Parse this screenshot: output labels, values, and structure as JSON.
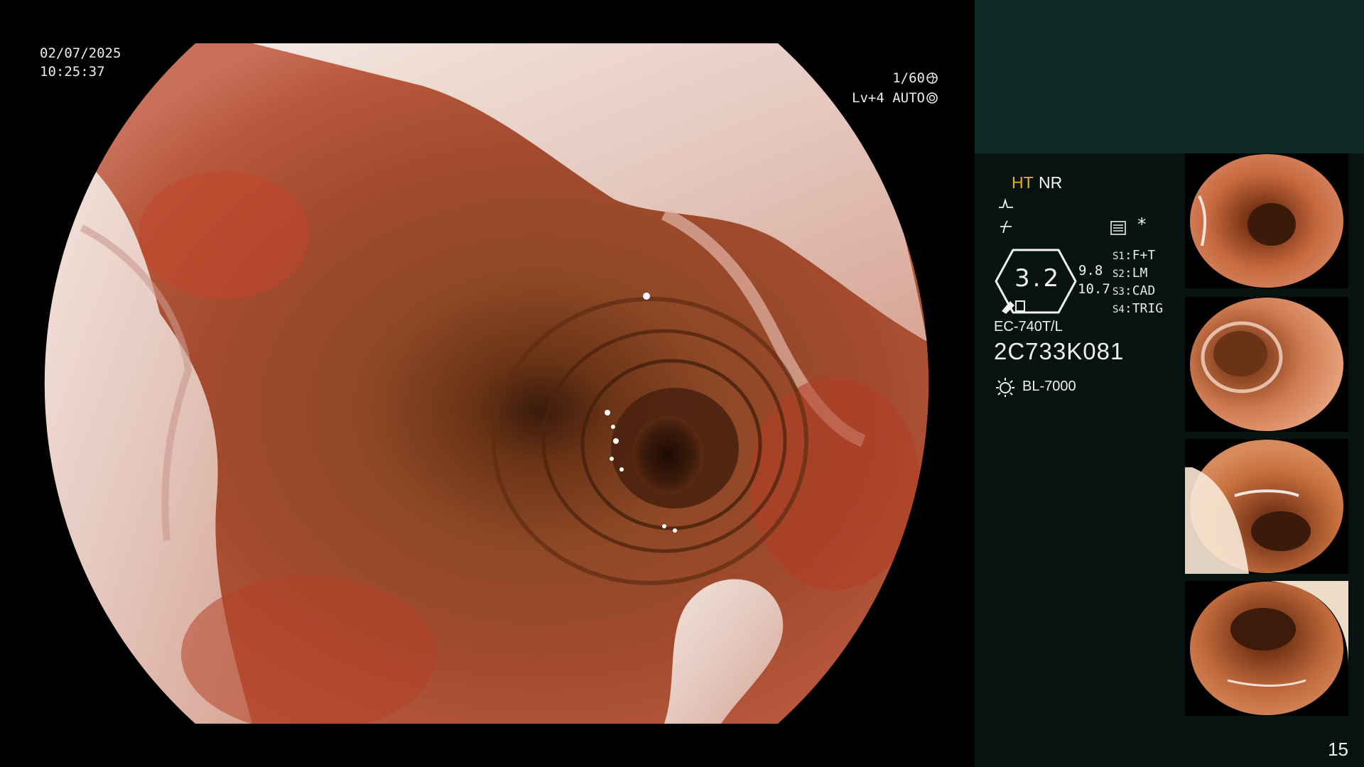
{
  "osd": {
    "date": "02/07/2025",
    "time": "10:25:37",
    "shutter": "1/60",
    "level": "Lv+4 AUTO"
  },
  "panel": {
    "mode_primary": "HT",
    "mode_secondary": "NR",
    "star": "*",
    "zoom_value": "3.2",
    "value_a": "9.8",
    "value_b": "10.7",
    "switch_keys": [
      "S1",
      "S2",
      "S3",
      "S4"
    ],
    "switch_values": [
      "F+T",
      "LM",
      "CAD",
      "TRIG"
    ],
    "scope_model": "EC-740T/L",
    "serial": "2C733K081",
    "light_source": "BL-7000",
    "page_number": "15"
  },
  "colors": {
    "panel_bg": "#061311",
    "panel_header_bg": "#0f2b27",
    "mode_accent": "#e8b020"
  },
  "icons": [
    "shutter-icon",
    "iris-icon",
    "gain-icon",
    "enhancement-icon",
    "structure-icon",
    "zoom-ring-icon",
    "light-source-icon"
  ],
  "thumbnails": [
    {
      "name": "thumbnail-1"
    },
    {
      "name": "thumbnail-2"
    },
    {
      "name": "thumbnail-3"
    },
    {
      "name": "thumbnail-4"
    }
  ]
}
